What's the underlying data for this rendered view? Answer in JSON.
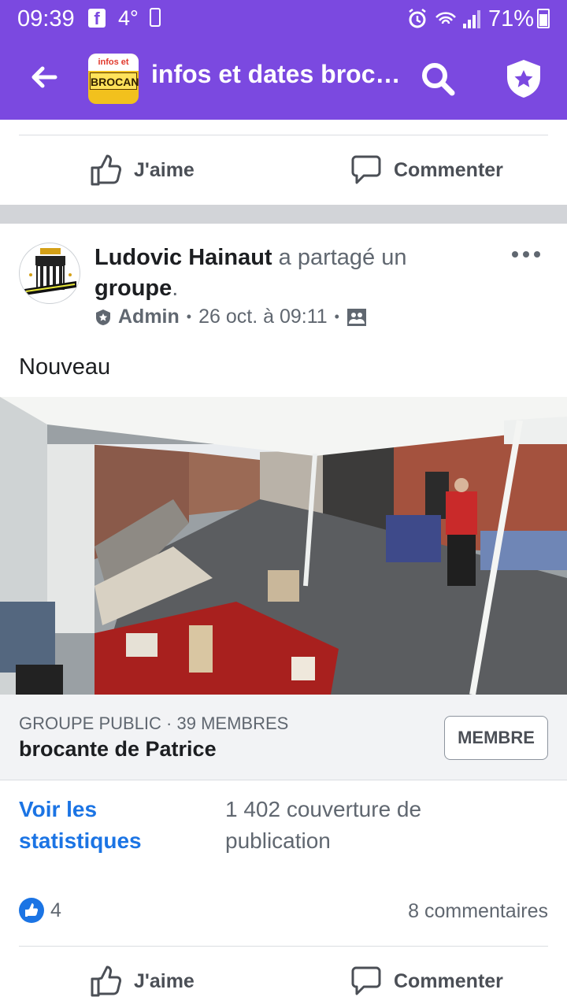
{
  "status_bar": {
    "time": "09:39",
    "notif_fb": "f",
    "temperature": "4°",
    "battery_percent": "71%"
  },
  "app_bar": {
    "title": "infos et dates broc…",
    "logo_top": "infos et dates",
    "logo_text": "BROCANTE"
  },
  "actions_top": {
    "like": "J'aime",
    "comment": "Commenter"
  },
  "post": {
    "author": "Ludovic Hainaut",
    "shared_text": " a partagé un ",
    "shared_object": "groupe",
    "shared_period": ".",
    "role": "Admin",
    "timestamp": "26 oct. à 09:11",
    "body": "Nouveau"
  },
  "group_card": {
    "kind": "GROUPE PUBLIC · 39 MEMBRES",
    "name": "brocante de Patrice",
    "button": "MEMBRE"
  },
  "insights": {
    "stats_link": "Voir les statistiques",
    "reach": "1 402 couverture de publication"
  },
  "reactions": {
    "likes_count": "4",
    "comments_count": "8 commentaires"
  },
  "actions_bottom": {
    "like": "J'aime",
    "comment": "Commenter"
  },
  "colors": {
    "brand": "#7b49e0",
    "link": "#1b74e4"
  }
}
